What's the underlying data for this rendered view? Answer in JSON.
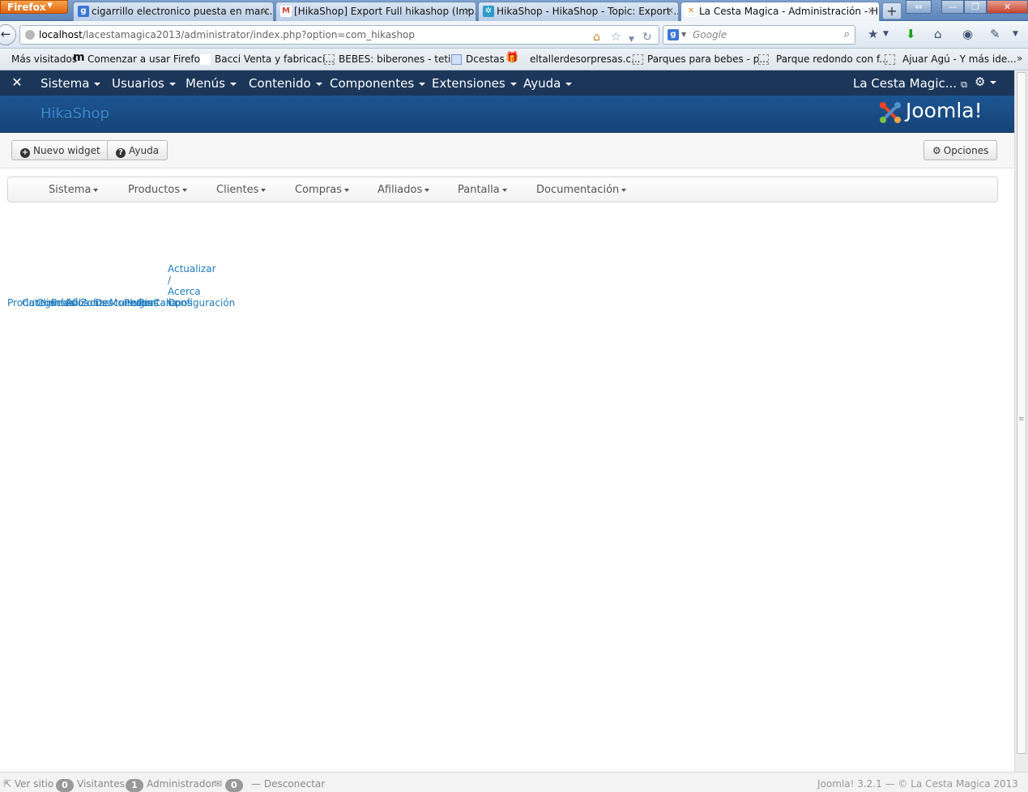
{
  "browser": {
    "app_button": "Firefox",
    "tabs": [
      {
        "title": "cigarrillo electronico puesta en marc...",
        "favicon": "google-icon",
        "color": "#3a76d6",
        "glyph": "g"
      },
      {
        "title": "[HikaShop] Export Full hikashop (Imp...",
        "favicon": "gmail-icon",
        "color": "#d44638",
        "glyph": "M"
      },
      {
        "title": "HikaShop - HikaShop - Topic: Export ...",
        "favicon": "hikashop-icon",
        "color": "#2d9cc8",
        "glyph": "✲"
      },
      {
        "title": "La Cesta Magica - Administración - H...",
        "favicon": "joomla-icon",
        "color": "#e0802b",
        "glyph": "✕"
      }
    ],
    "url": {
      "host": "localhost",
      "path": "/lacestamagica2013/administrator/index.php?option=com_hikashop"
    },
    "search_placeholder": "Google",
    "bookmarks": [
      "Más visitados",
      "Comenzar a usar Firefox",
      "Bacci Venta y fabricaci...",
      "BEBES: biberones - teti...",
      "Dcestas",
      "eltallerdesorpresas.c...",
      "Parques para bebes - p...",
      "Parque redondo con f...",
      "Ajuar Agú - Y más ide..."
    ],
    "bookmarks_more": "»"
  },
  "joomla": {
    "menu": [
      "Sistema",
      "Usuarios",
      "Menús",
      "Contenido",
      "Componentes",
      "Extensiones",
      "Ayuda"
    ],
    "site_name": "La Cesta Magic...",
    "page_title": "HikaShop",
    "logo_text": "Joomla!",
    "colors": {
      "nav_bg": "#1b3659",
      "header_bg": "#1c5592",
      "link": "#1f7cbf"
    }
  },
  "toolbar": {
    "new_widget": "Nuevo widget",
    "help": "Ayuda",
    "options": "Opciones"
  },
  "hikamenu": [
    "Sistema",
    "Productos",
    "Clientes",
    "Compras",
    "Afiliados",
    "Pantalla",
    "Documentación"
  ],
  "dashboard_links": {
    "update": "Actualizar",
    "slash": "/",
    "about": "Acerca",
    "config": "Configuración",
    "overlapped": [
      "Productos",
      "Categorías",
      "Clientes",
      "Pedidos",
      "Afiliados",
      "Zonas",
      "Descuentos",
      "Monedas",
      "Plugins",
      "Pantalla",
      "Campos"
    ]
  },
  "statusbar": {
    "view_site": "Ver sitio",
    "visitors_count": "0",
    "visitors": "Visitantes",
    "admin_count": "1",
    "admin": "Administrador",
    "messages_count": "0",
    "logout": "Desconectar",
    "version": "Joomla! 3.2.1",
    "copyright": "— © La Cesta Magica 2013"
  }
}
